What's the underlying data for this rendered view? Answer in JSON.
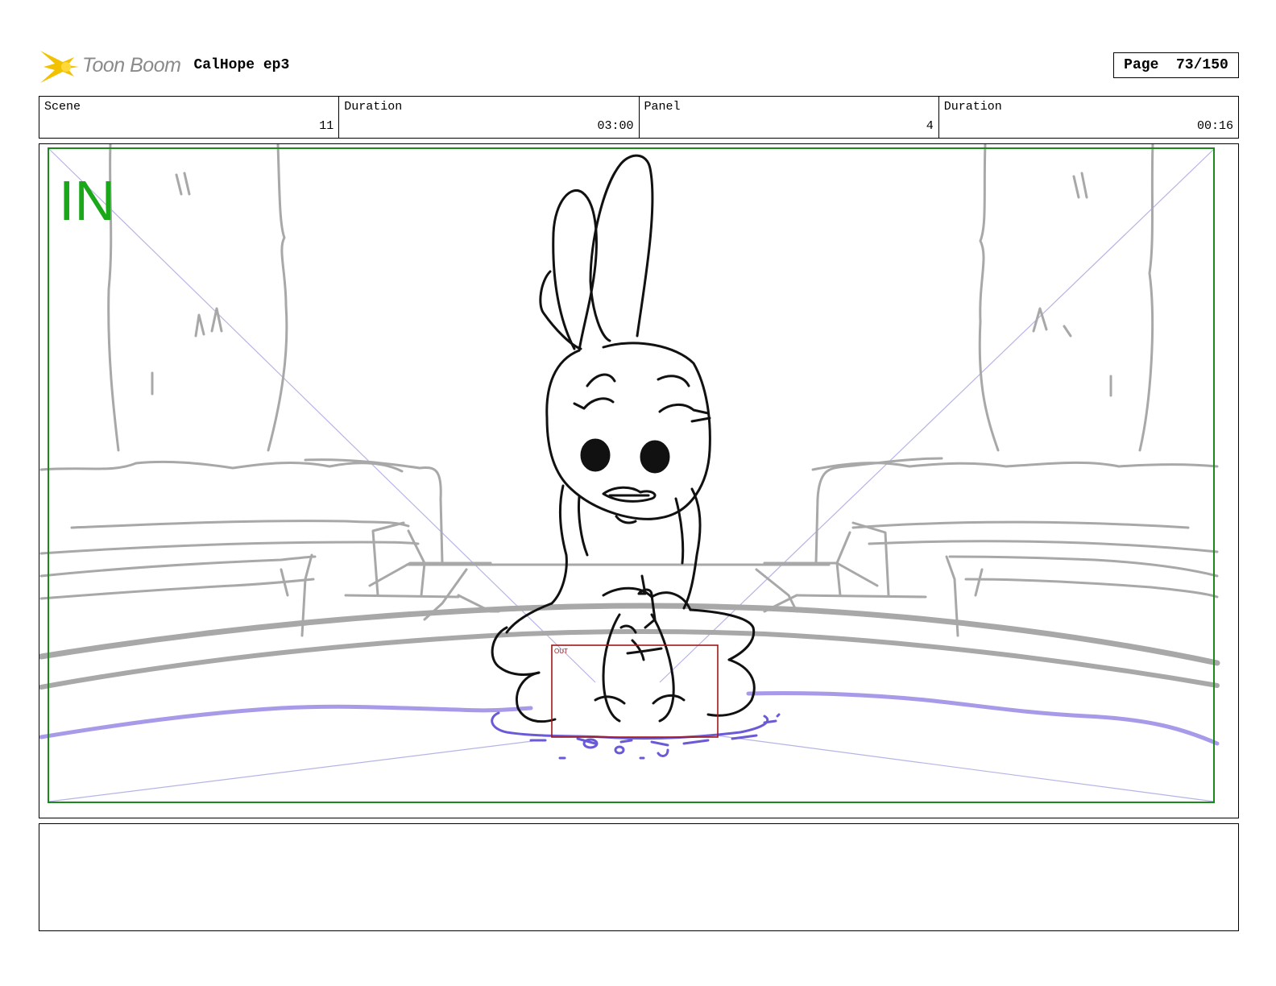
{
  "header": {
    "logo_text": "Toon Boom",
    "project_title": "CalHope ep3",
    "page_label": "Page",
    "page_number": "73/150"
  },
  "info": {
    "scene_label": "Scene",
    "scene_value": "11",
    "scene_duration_label": "Duration",
    "scene_duration_value": "03:00",
    "panel_label": "Panel",
    "panel_value": "4",
    "panel_duration_label": "Duration",
    "panel_duration_value": "00:16"
  },
  "panel": {
    "in_marker": "IN",
    "out_marker": "OUT"
  },
  "caption": {
    "text": ""
  },
  "colors": {
    "in_frame": "#1a8a1a",
    "out_frame": "#a01818",
    "background_sketch": "#a8a8a8",
    "character_line": "#111111",
    "water": "#6a5ad8",
    "perspective": "#b4b4e6",
    "logo_flame": "#f2c200"
  }
}
